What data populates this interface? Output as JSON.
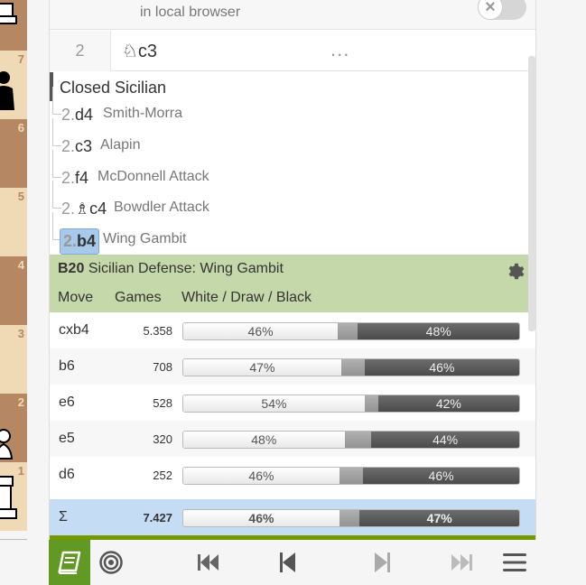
{
  "board": {
    "ranks": [
      "7",
      "6",
      "5",
      "4",
      "3",
      "2",
      "1"
    ]
  },
  "explorer": {
    "local_text": "in local browser"
  },
  "current_move": {
    "index": "2",
    "san": "♘c3",
    "more": "..."
  },
  "variations": {
    "title": "Closed Sicilian",
    "lines": [
      {
        "num": "2.",
        "move": "d4",
        "name": "Smith-Morra"
      },
      {
        "num": "2.",
        "move": "c3",
        "name": "Alapin"
      },
      {
        "num": "2.",
        "move": "f4",
        "name": "McDonnell Attack"
      },
      {
        "num": "2.",
        "move": "♗c4",
        "name": "Bowdler Attack"
      },
      {
        "num": "2.",
        "move": "b4",
        "name": "Wing Gambit"
      }
    ]
  },
  "opening": {
    "eco": "B20",
    "name": "Sicilian Defense: Wing Gambit",
    "col_move": "Move",
    "col_games": "Games",
    "col_result": "White / Draw / Black"
  },
  "moves": [
    {
      "move": "cxb4",
      "games": "5.358",
      "white": 46,
      "draw": 6,
      "black": 48,
      "white_label": "46%",
      "black_label": "48%"
    },
    {
      "move": "b6",
      "games": "708",
      "white": 47,
      "draw": 7,
      "black": 46,
      "white_label": "47%",
      "black_label": "46%"
    },
    {
      "move": "e6",
      "games": "528",
      "white": 54,
      "draw": 4,
      "black": 42,
      "white_label": "54%",
      "black_label": "42%"
    },
    {
      "move": "e5",
      "games": "320",
      "white": 48,
      "draw": 8,
      "black": 44,
      "white_label": "48%",
      "black_label": "44%"
    },
    {
      "move": "d6",
      "games": "252",
      "white": 46,
      "draw": 7,
      "black": 46,
      "white_label": "46%",
      "black_label": "46%"
    }
  ],
  "summary": {
    "symbol": "Σ",
    "games": "7.427",
    "white": 46,
    "draw": 6,
    "black": 47,
    "white_label": "46%",
    "black_label": "47%"
  },
  "colors": {
    "opening_header": "#c5d8a9",
    "summary_row": "#c4dcf4",
    "book_button": "#629924",
    "active_move": "#a7c9ea"
  }
}
